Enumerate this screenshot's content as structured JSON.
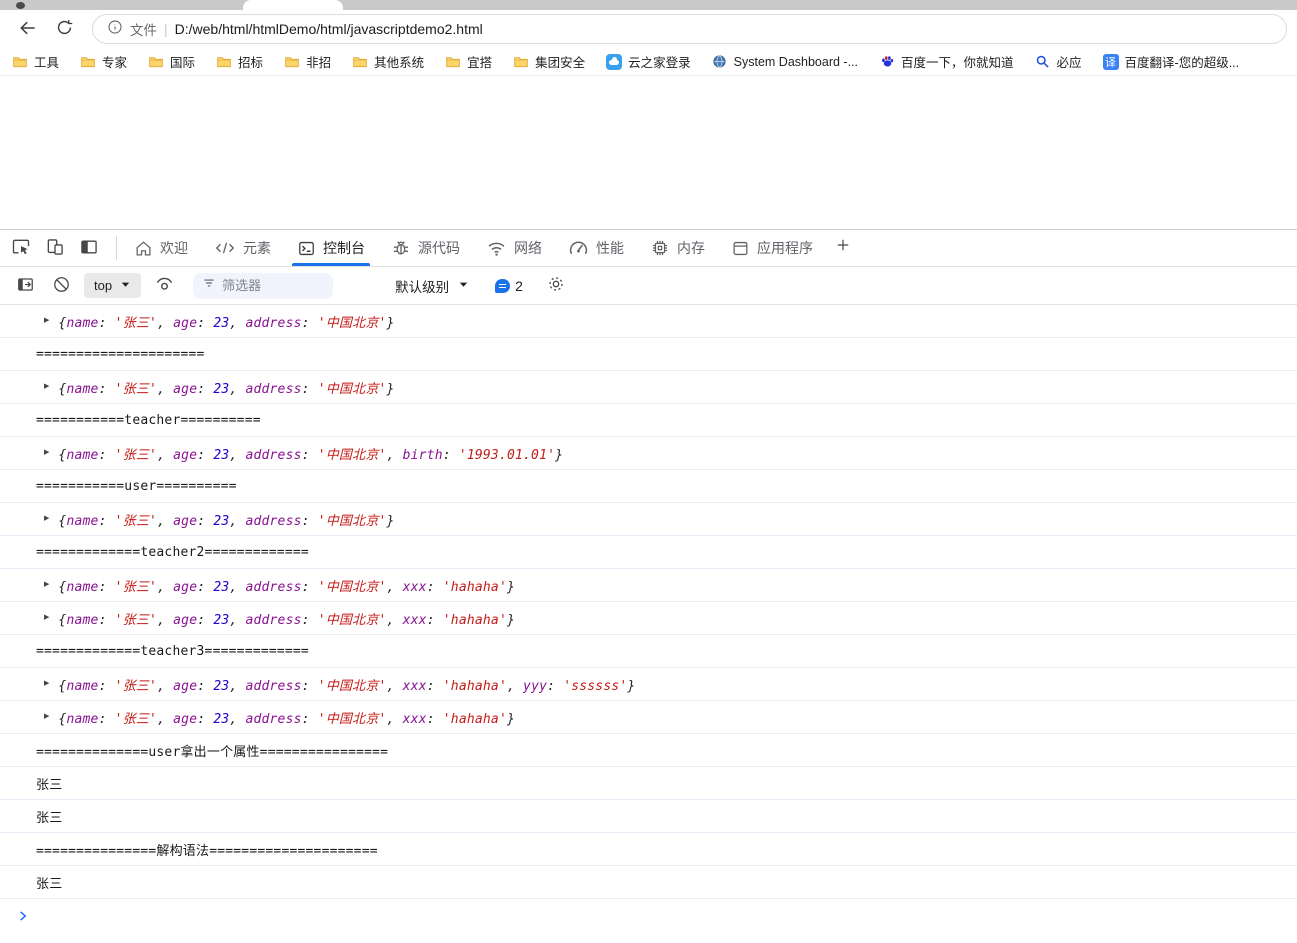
{
  "accent_color": "#1a73e8",
  "browser": {
    "nav": {
      "scheme_label": "文件",
      "url": "D:/web/html/htmlDemo/html/javascriptdemo2.html"
    },
    "bookmarks": [
      {
        "name": "tools",
        "label": "工具",
        "icon": "folder"
      },
      {
        "name": "experts",
        "label": "专家",
        "icon": "folder"
      },
      {
        "name": "intl",
        "label": "国际",
        "icon": "folder"
      },
      {
        "name": "bidding",
        "label": "招标",
        "icon": "folder"
      },
      {
        "name": "nonbid",
        "label": "非招",
        "icon": "folder"
      },
      {
        "name": "other-systems",
        "label": "其他系统",
        "icon": "folder"
      },
      {
        "name": "yida",
        "label": "宜搭",
        "icon": "folder"
      },
      {
        "name": "group-security",
        "label": "集团安全",
        "icon": "folder"
      },
      {
        "name": "cloudhub-login",
        "label": "云之家登录",
        "icon": "cloudapp"
      },
      {
        "name": "system-dashboard",
        "label": "System Dashboard -...",
        "icon": "globe"
      },
      {
        "name": "baidu",
        "label": "百度一下，你就知道",
        "icon": "paw"
      },
      {
        "name": "bing",
        "label": "必应",
        "icon": "magnifier"
      },
      {
        "name": "baidu-translate",
        "label": "百度翻译-您的超级...",
        "icon": "translate",
        "icon_text": "译"
      }
    ]
  },
  "devtools": {
    "left_icons": [
      {
        "name": "inspect-element",
        "icon": "inspect"
      },
      {
        "name": "device-toolbar",
        "icon": "devices"
      },
      {
        "name": "dock-side",
        "icon": "dock"
      }
    ],
    "tabs": [
      {
        "name": "welcome",
        "label": "欢迎",
        "icon": "home",
        "active": false
      },
      {
        "name": "elements",
        "label": "元素",
        "icon": "code",
        "active": false
      },
      {
        "name": "console",
        "label": "控制台",
        "icon": "console",
        "active": true
      },
      {
        "name": "sources",
        "label": "源代码",
        "icon": "bug",
        "active": false
      },
      {
        "name": "network",
        "label": "网络",
        "icon": "wifi",
        "active": false
      },
      {
        "name": "performance",
        "label": "性能",
        "icon": "gauge",
        "active": false
      },
      {
        "name": "memory",
        "label": "内存",
        "icon": "chip",
        "active": false
      },
      {
        "name": "application",
        "label": "应用程序",
        "icon": "window",
        "active": false
      }
    ],
    "toolbar": {
      "context_label": "top",
      "filter_placeholder": "筛选器",
      "level_label": "默认级别",
      "message_count": "2"
    },
    "console": {
      "colors": {
        "key": "#881391",
        "string": "#c41a16",
        "number": "#1c00cf"
      },
      "messages": [
        {
          "kind": "object",
          "pairs": [
            {
              "k": "name",
              "v": "'张三'",
              "t": "s"
            },
            {
              "k": "age",
              "v": "23",
              "t": "n"
            },
            {
              "k": "address",
              "v": "'中国北京'",
              "t": "s"
            }
          ]
        },
        {
          "kind": "log",
          "text": "====================="
        },
        {
          "kind": "object",
          "pairs": [
            {
              "k": "name",
              "v": "'张三'",
              "t": "s"
            },
            {
              "k": "age",
              "v": "23",
              "t": "n"
            },
            {
              "k": "address",
              "v": "'中国北京'",
              "t": "s"
            }
          ]
        },
        {
          "kind": "log",
          "text": "===========teacher=========="
        },
        {
          "kind": "object",
          "pairs": [
            {
              "k": "name",
              "v": "'张三'",
              "t": "s"
            },
            {
              "k": "age",
              "v": "23",
              "t": "n"
            },
            {
              "k": "address",
              "v": "'中国北京'",
              "t": "s"
            },
            {
              "k": "birth",
              "v": "'1993.01.01'",
              "t": "s"
            }
          ]
        },
        {
          "kind": "log",
          "text": "===========user=========="
        },
        {
          "kind": "object",
          "pairs": [
            {
              "k": "name",
              "v": "'张三'",
              "t": "s"
            },
            {
              "k": "age",
              "v": "23",
              "t": "n"
            },
            {
              "k": "address",
              "v": "'中国北京'",
              "t": "s"
            }
          ]
        },
        {
          "kind": "log",
          "text": "=============teacher2============="
        },
        {
          "kind": "object",
          "pairs": [
            {
              "k": "name",
              "v": "'张三'",
              "t": "s"
            },
            {
              "k": "age",
              "v": "23",
              "t": "n"
            },
            {
              "k": "address",
              "v": "'中国北京'",
              "t": "s"
            },
            {
              "k": "xxx",
              "v": "'hahaha'",
              "t": "s"
            }
          ]
        },
        {
          "kind": "object",
          "pairs": [
            {
              "k": "name",
              "v": "'张三'",
              "t": "s"
            },
            {
              "k": "age",
              "v": "23",
              "t": "n"
            },
            {
              "k": "address",
              "v": "'中国北京'",
              "t": "s"
            },
            {
              "k": "xxx",
              "v": "'hahaha'",
              "t": "s"
            }
          ]
        },
        {
          "kind": "log",
          "text": "=============teacher3============="
        },
        {
          "kind": "object",
          "pairs": [
            {
              "k": "name",
              "v": "'张三'",
              "t": "s"
            },
            {
              "k": "age",
              "v": "23",
              "t": "n"
            },
            {
              "k": "address",
              "v": "'中国北京'",
              "t": "s"
            },
            {
              "k": "xxx",
              "v": "'hahaha'",
              "t": "s"
            },
            {
              "k": "yyy",
              "v": "'ssssss'",
              "t": "s"
            }
          ]
        },
        {
          "kind": "object",
          "pairs": [
            {
              "k": "name",
              "v": "'张三'",
              "t": "s"
            },
            {
              "k": "age",
              "v": "23",
              "t": "n"
            },
            {
              "k": "address",
              "v": "'中国北京'",
              "t": "s"
            },
            {
              "k": "xxx",
              "v": "'hahaha'",
              "t": "s"
            }
          ]
        },
        {
          "kind": "log",
          "text": "==============user拿出一个属性================"
        },
        {
          "kind": "log",
          "text": "张三"
        },
        {
          "kind": "log",
          "text": "张三"
        },
        {
          "kind": "log",
          "text": "===============解构语法====================="
        },
        {
          "kind": "log",
          "text": "张三"
        }
      ]
    }
  }
}
